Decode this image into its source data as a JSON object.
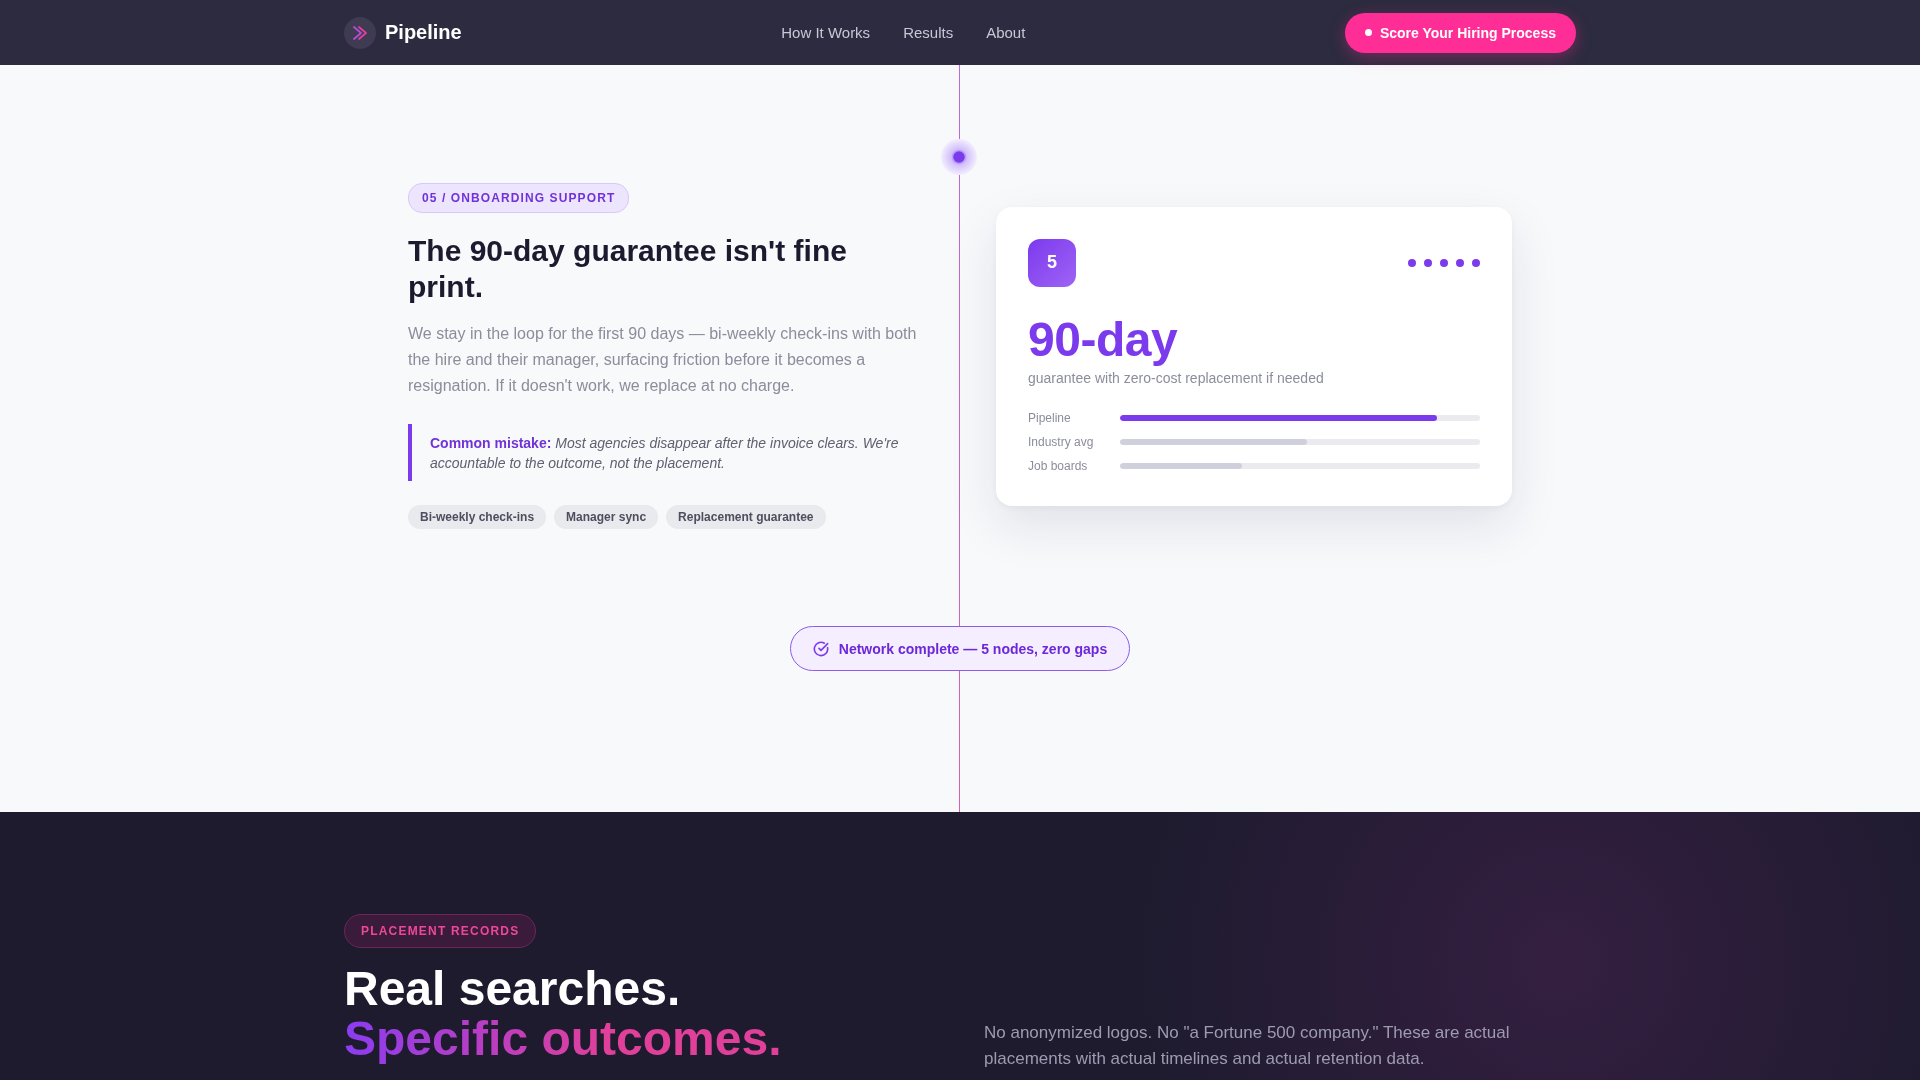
{
  "nav": {
    "brand": "Pipeline",
    "links": [
      {
        "label": "How It Works"
      },
      {
        "label": "Results"
      },
      {
        "label": "About"
      }
    ],
    "cta": "Score Your Hiring Process"
  },
  "step": {
    "eyebrow": "05 / ONBOARDING SUPPORT",
    "title": "The 90-day guarantee isn't fine print.",
    "body": "We stay in the loop for the first 90 days — bi-weekly check-ins with both the hire and their manager, surfacing friction before it becomes a resignation. If it doesn't work, we replace at no charge.",
    "callout": "**Common mistake:** *Most agencies disappear after the invoice clears. We're accountable to the outcome, not the placement.*",
    "tags": [
      "Bi-weekly check-ins",
      "Manager sync",
      "Replacement guarantee"
    ]
  },
  "card": {
    "number": "5",
    "step_dots": [
      {
        "done": true
      },
      {
        "done": true
      },
      {
        "done": true
      },
      {
        "done": true
      },
      {
        "done": true
      }
    ],
    "stat": "90-day",
    "caption": "guarantee with zero-cost replacement if needed",
    "bars": [
      {
        "label": "Pipeline",
        "level": 0.88,
        "highlighted": true
      },
      {
        "label": "Industry avg",
        "level": 0.52,
        "highlighted": false
      },
      {
        "label": "Job boards",
        "level": 0.34,
        "highlighted": false
      }
    ]
  },
  "status": {
    "text": "Network complete — 5 nodes, zero gaps"
  },
  "records": {
    "eyebrow": "PLACEMENT RECORDS",
    "title": "Real searches.",
    "title_accent": "Specific outcomes.",
    "body": "No anonymized logos. No \"a Fortune 500 company.\" These are actual placements with actual timelines and actual retention data."
  }
}
